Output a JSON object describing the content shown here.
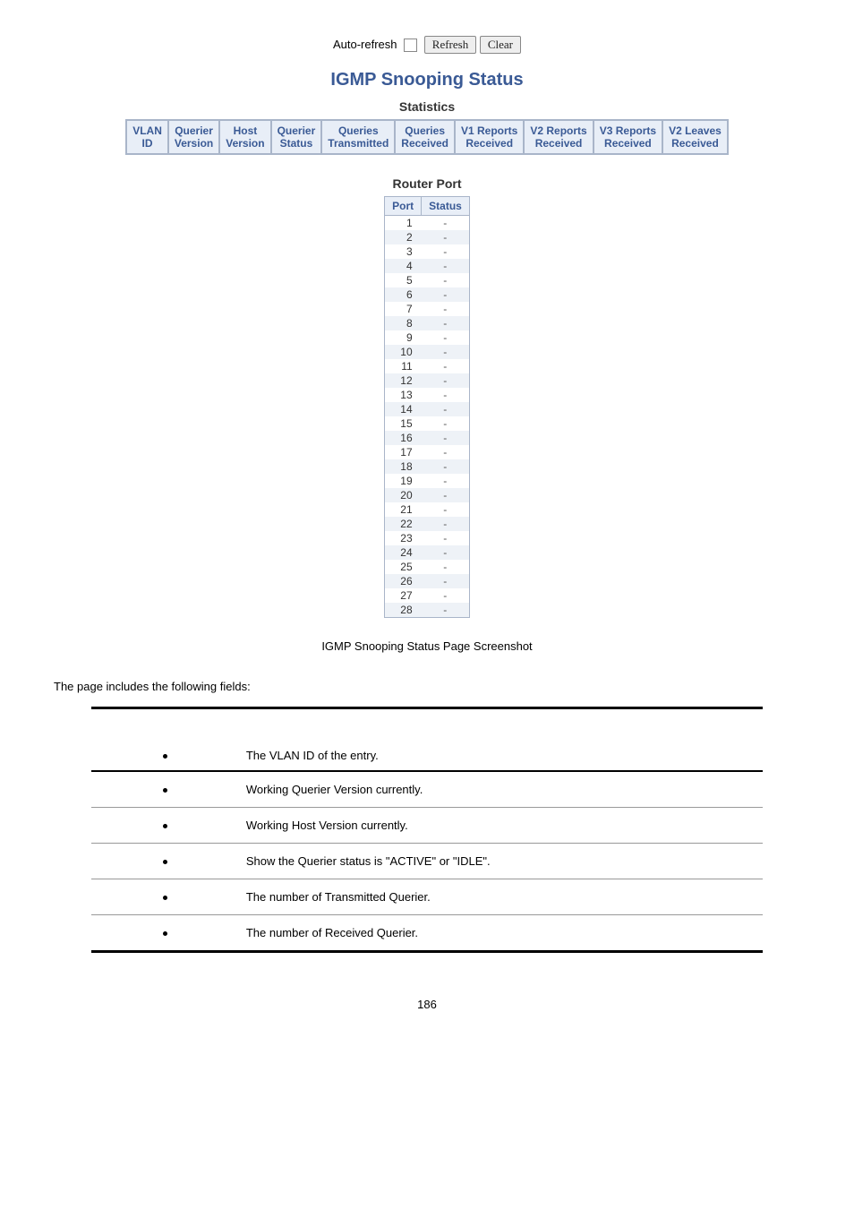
{
  "controls": {
    "auto_refresh_label": "Auto-refresh",
    "refresh_label": "Refresh",
    "clear_label": "Clear"
  },
  "ui_title": "IGMP Snooping Status",
  "statistics_subtitle": "Statistics",
  "stats_headers": [
    "VLAN\nID",
    "Querier\nVersion",
    "Host\nVersion",
    "Querier\nStatus",
    "Queries\nTransmitted",
    "Queries\nReceived",
    "V1 Reports\nReceived",
    "V2 Reports\nReceived",
    "V3 Reports\nReceived",
    "V2 Leaves\nReceived"
  ],
  "router_port_subtitle": "Router Port",
  "router_headers": {
    "port": "Port",
    "status": "Status"
  },
  "router_rows": [
    {
      "port": "1",
      "status": "-"
    },
    {
      "port": "2",
      "status": "-"
    },
    {
      "port": "3",
      "status": "-"
    },
    {
      "port": "4",
      "status": "-"
    },
    {
      "port": "5",
      "status": "-"
    },
    {
      "port": "6",
      "status": "-"
    },
    {
      "port": "7",
      "status": "-"
    },
    {
      "port": "8",
      "status": "-"
    },
    {
      "port": "9",
      "status": "-"
    },
    {
      "port": "10",
      "status": "-"
    },
    {
      "port": "11",
      "status": "-"
    },
    {
      "port": "12",
      "status": "-"
    },
    {
      "port": "13",
      "status": "-"
    },
    {
      "port": "14",
      "status": "-"
    },
    {
      "port": "15",
      "status": "-"
    },
    {
      "port": "16",
      "status": "-"
    },
    {
      "port": "17",
      "status": "-"
    },
    {
      "port": "18",
      "status": "-"
    },
    {
      "port": "19",
      "status": "-"
    },
    {
      "port": "20",
      "status": "-"
    },
    {
      "port": "21",
      "status": "-"
    },
    {
      "port": "22",
      "status": "-"
    },
    {
      "port": "23",
      "status": "-"
    },
    {
      "port": "24",
      "status": "-"
    },
    {
      "port": "25",
      "status": "-"
    },
    {
      "port": "26",
      "status": "-"
    },
    {
      "port": "27",
      "status": "-"
    },
    {
      "port": "28",
      "status": "-"
    }
  ],
  "screenshot_caption": "IGMP Snooping Status Page Screenshot",
  "intro_text": "The page includes the following fields:",
  "fields": [
    {
      "desc": "The VLAN ID of the entry."
    },
    {
      "desc": "Working Querier Version currently."
    },
    {
      "desc": "Working Host Version currently."
    },
    {
      "desc": "Show the Querier status is \"ACTIVE\" or \"IDLE\"."
    },
    {
      "desc": "The number of Transmitted Querier."
    },
    {
      "desc": "The number of Received Querier."
    }
  ],
  "page_number": "186"
}
